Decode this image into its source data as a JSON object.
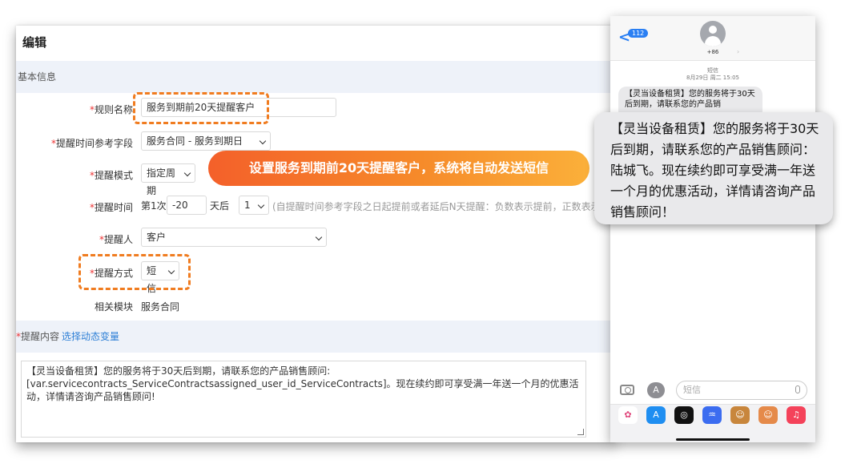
{
  "editor": {
    "title": "编辑",
    "basic_section": "基本信息",
    "fields": {
      "rule_name": {
        "label": "规则名称",
        "value": "服务到期前20天提醒客户"
      },
      "ref_field": {
        "label": "提醒时间参考字段",
        "value": "服务合同 - 服务到期日"
      },
      "mode": {
        "label": "提醒模式",
        "value": "指定周期"
      },
      "time": {
        "label": "提醒时间",
        "prefix": "第1次",
        "offset": "-20",
        "unit": "天后",
        "hour": "1",
        "hint": "(自提醒时间参考字段之日起提前或者延后N天提醒：负数表示提前，正数表示延"
      },
      "person": {
        "label": "提醒人",
        "value": "客户"
      },
      "method": {
        "label": "提醒方式",
        "value": "短信"
      },
      "module": {
        "label": "相关模块",
        "value": "服务合同"
      }
    },
    "content_section": {
      "label": "提醒内容",
      "link": "选择动态变量"
    },
    "content_text": "【灵当设备租赁】您的服务将于30天后到期，请联系您的产品销售顾问: [var.servicecontracts_ServiceContractsassigned_user_id_ServiceContracts]。现在续约即可享受满一年送一个月的优惠活动，详情请咨询产品销售顾问!"
  },
  "banner": "设置服务到期前20天提醒客户，系统将自动发送短信",
  "phone": {
    "back_count": "112",
    "contact": "+86",
    "meta_line1": "短信",
    "meta_line2": "8月29日 周二 15:05",
    "small_bubble": "【灵当设备租赁】您的服务将于30天后到期，请联系您的产品销",
    "input_placeholder": "短信",
    "apps_label": "A",
    "apps": [
      {
        "name": "photos-app-icon",
        "color": "#ffffff",
        "glyph": "✿"
      },
      {
        "name": "app-store-icon",
        "color": "#1f8ef1",
        "glyph": "A"
      },
      {
        "name": "activity-app-icon",
        "color": "#111111",
        "glyph": "◎"
      },
      {
        "name": "audio-message-icon",
        "color": "#3b6cf0",
        "glyph": "♒"
      },
      {
        "name": "memoji-icon-1",
        "color": "#c8863c",
        "glyph": "☺"
      },
      {
        "name": "memoji-icon-2",
        "color": "#e58a4a",
        "glyph": "☺"
      },
      {
        "name": "music-app-icon",
        "color": "#f4425a",
        "glyph": "♫"
      }
    ]
  },
  "big_bubble": "【灵当设备租赁】您的服务将于30天后到期，请联系您的产品销售顾问：陆城飞。现在续约即可享受满一年送一个月的优惠活动，详情请咨询产品销售顾问！"
}
